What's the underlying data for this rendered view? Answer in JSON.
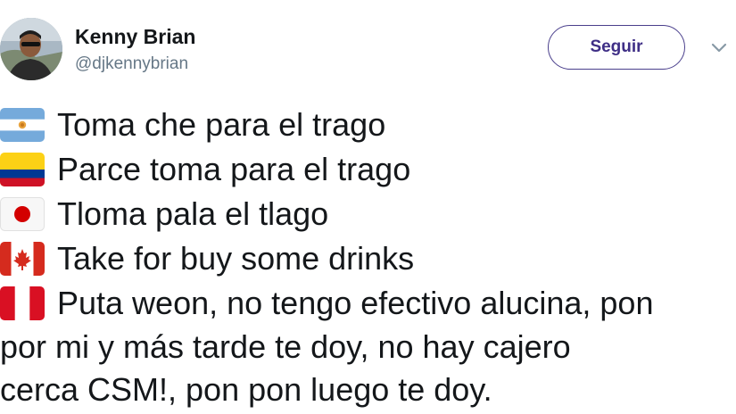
{
  "header": {
    "name": "Kenny Brian",
    "handle": "@djkennybrian",
    "follow_label": "Seguir"
  },
  "icons": {
    "more": "chevron-down-icon",
    "flags": [
      "argentina-flag-icon",
      "colombia-flag-icon",
      "japan-flag-icon",
      "canada-flag-icon",
      "peru-flag-icon"
    ]
  },
  "tweet": {
    "lines": [
      "Toma che para el trago",
      "Parce toma para el trago",
      "Tloma pala el tlago",
      "Take for buy some drinks",
      "Puta weon, no tengo efectivo alucina, pon"
    ],
    "continuation": [
      "por mi y más tarde te doy, no hay cajero",
      "cerca CSM!, pon pon luego te doy."
    ]
  },
  "colors": {
    "accent": "#3f2f86",
    "text": "#14171a",
    "secondary": "#657786"
  }
}
